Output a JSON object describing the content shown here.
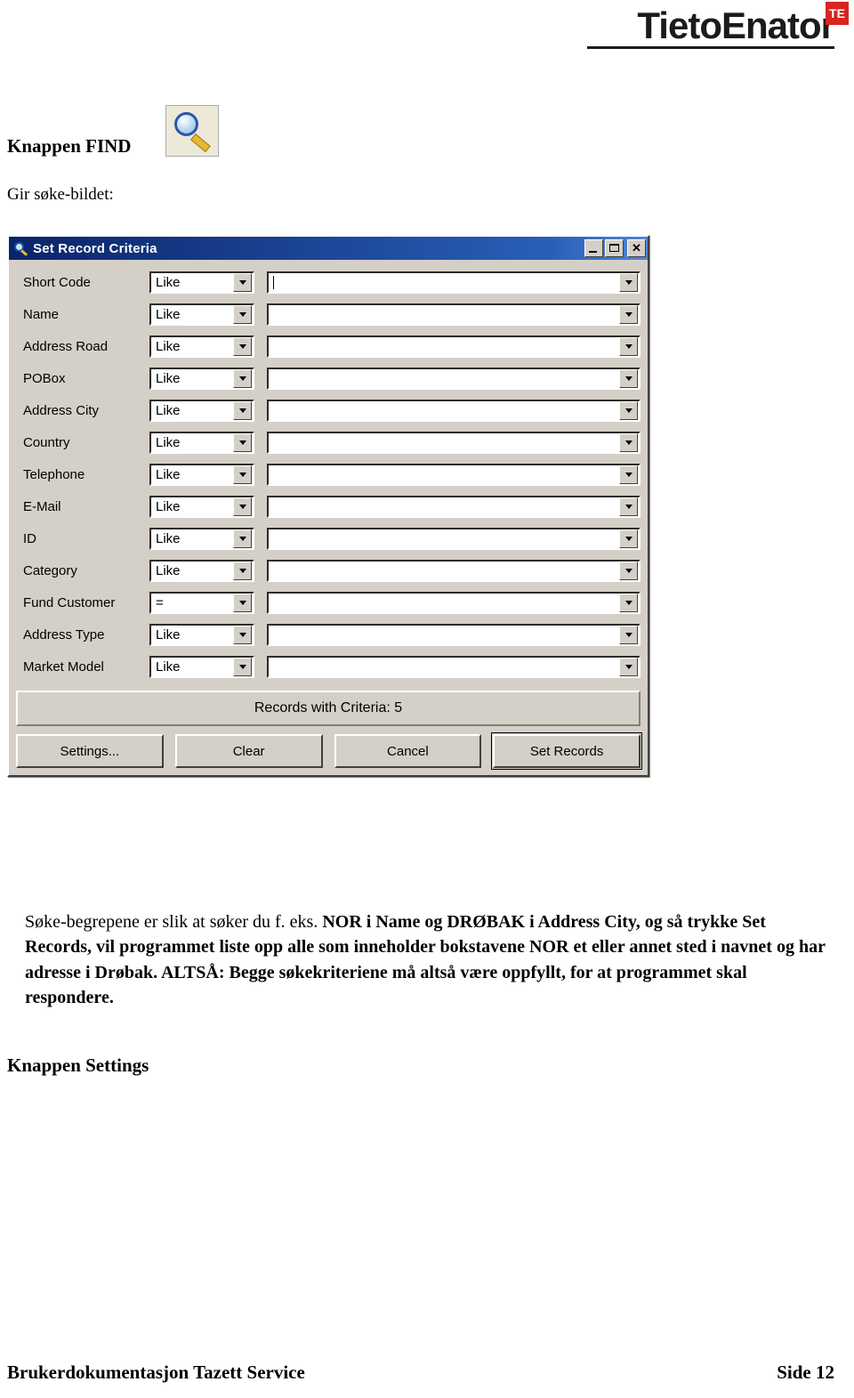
{
  "brand": {
    "name": "TietoEnator",
    "badge": "TE",
    "accent": "#d9241f"
  },
  "headings": {
    "find": "Knappen FIND",
    "settings": "Knappen Settings",
    "intro": "Gir søke-bildet:"
  },
  "icons": {
    "find": "magnifier-icon"
  },
  "dialog": {
    "title": "Set Record Criteria",
    "window_buttons": {
      "minimize": "_",
      "maximize": "❐",
      "close": "✕"
    },
    "rows": [
      {
        "label": "Short Code",
        "operator": "Like",
        "value": "",
        "cursor": true
      },
      {
        "label": "Name",
        "operator": "Like",
        "value": ""
      },
      {
        "label": "Address Road",
        "operator": "Like",
        "value": ""
      },
      {
        "label": "POBox",
        "operator": "Like",
        "value": ""
      },
      {
        "label": "Address City",
        "operator": "Like",
        "value": ""
      },
      {
        "label": "Country",
        "operator": "Like",
        "value": ""
      },
      {
        "label": "Telephone",
        "operator": "Like",
        "value": ""
      },
      {
        "label": "E-Mail",
        "operator": "Like",
        "value": ""
      },
      {
        "label": "ID",
        "operator": "Like",
        "value": ""
      },
      {
        "label": "Category",
        "operator": "Like",
        "value": ""
      },
      {
        "label": "Fund Customer",
        "operator": "=",
        "value": ""
      },
      {
        "label": "Address Type",
        "operator": "Like",
        "value": ""
      },
      {
        "label": "Market Model",
        "operator": "Like",
        "value": ""
      }
    ],
    "status": "Records with Criteria: 5",
    "buttons": [
      {
        "label": "Settings...",
        "default": false
      },
      {
        "label": "Clear",
        "default": false
      },
      {
        "label": "Cancel",
        "default": false
      },
      {
        "label": "Set Records",
        "default": true
      }
    ]
  },
  "body": {
    "paragraph_part1": "Søke-begrepene er slik at søker du f. eks. ",
    "paragraph_bold": "NOR i Name og DRØBAK i Address City, og så trykke Set Records, vil programmet liste opp alle som inneholder bokstavene NOR et eller annet sted i navnet og har adresse i Drøbak. ALTSÅ: Begge søkekriteriene må altså være oppfyllt, for at programmet skal respondere."
  },
  "footer": {
    "left": "Brukerdokumentasjon Tazett Service",
    "right": "Side 12"
  }
}
